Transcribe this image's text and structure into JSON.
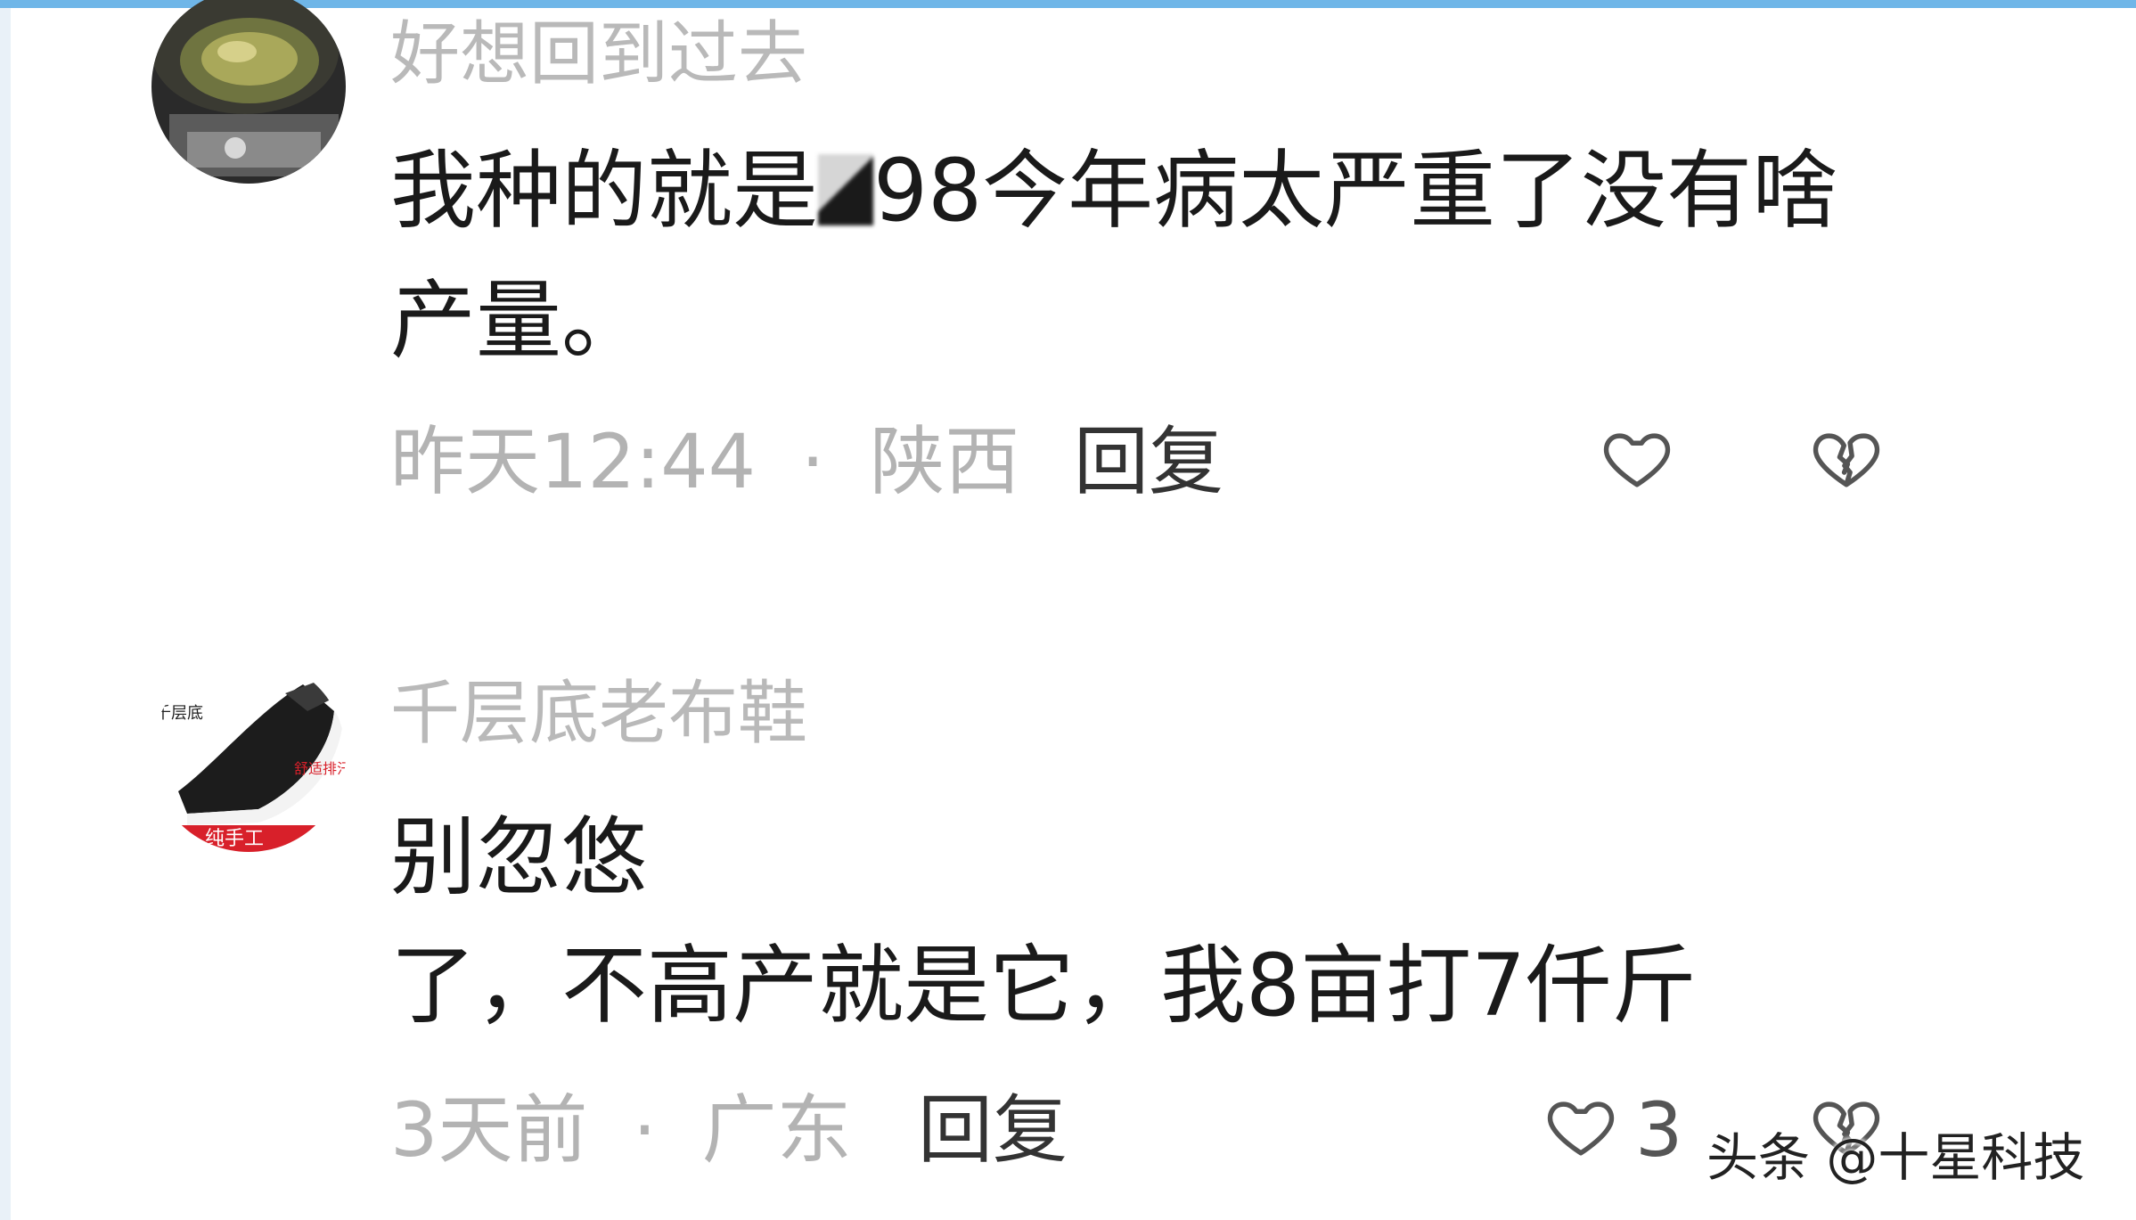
{
  "comments": [
    {
      "username": "好想回到过去",
      "text_before": "我种的就是",
      "text_after": "98今年病太严重了没有啥",
      "text_line2": "产量。",
      "time": "昨天12:44",
      "separator": "·",
      "location": "陕西",
      "reply_label": "回复",
      "like_icon": "heart-outline-icon",
      "dislike_icon": "broken-heart-icon"
    },
    {
      "username": "千层底老布鞋",
      "text_line1": "别忽悠",
      "text_line2": "了，不高产就是它，我8亩打7仟斤",
      "time": "3天前",
      "separator": "·",
      "location": "广东",
      "reply_label": "回复",
      "like_count": "3",
      "like_icon": "heart-outline-icon",
      "dislike_icon": "broken-heart-icon",
      "avatar_text_left": "千层底",
      "avatar_text_right": "舒适排汗防臭",
      "avatar_text_bottom": "纯手工"
    }
  ],
  "watermark": "头条 @十星科技",
  "colors": {
    "top_bar": "#6fb6e8",
    "username": "#b9b9b9",
    "body_text": "#1a1a1a",
    "meta": "#b3b3b3"
  }
}
